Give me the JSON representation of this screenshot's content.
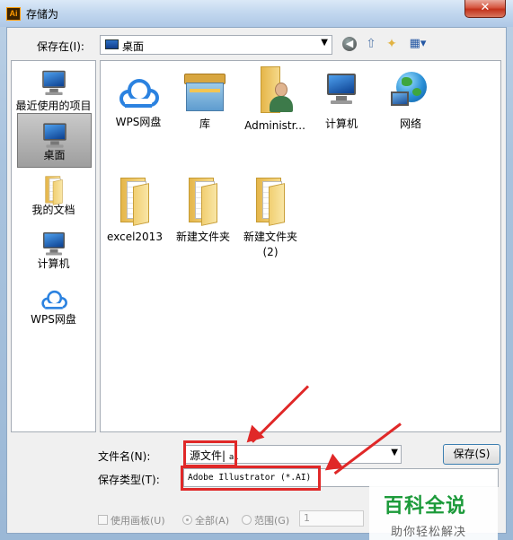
{
  "window": {
    "app_icon": "Ai",
    "title": "存储为",
    "close_label": "✕"
  },
  "toolbar": {
    "save_in_label": "保存在(I):",
    "save_in_value": "桌面",
    "icons": [
      "back-icon",
      "up-folder-icon",
      "new-folder-icon",
      "views-menu-icon"
    ]
  },
  "places": [
    {
      "label": "最近使用的项目",
      "icon": "recent-items-icon"
    },
    {
      "label": "桌面",
      "icon": "desktop-icon",
      "selected": true
    },
    {
      "label": "我的文档",
      "icon": "documents-icon"
    },
    {
      "label": "计算机",
      "icon": "computer-icon"
    },
    {
      "label": "WPS网盘",
      "icon": "wps-cloud-icon"
    }
  ],
  "files": [
    {
      "label": "WPS网盘",
      "icon": "wps-cloud-icon"
    },
    {
      "label": "库",
      "icon": "library-icon"
    },
    {
      "label": "Administr...",
      "icon": "user-folder-icon"
    },
    {
      "label": "计算机",
      "icon": "computer-icon"
    },
    {
      "label": "网络",
      "icon": "network-icon"
    },
    {
      "label": "excel2013",
      "icon": "folder-icon"
    },
    {
      "label": "新建文件夹",
      "icon": "folder-icon"
    },
    {
      "label": "新建文件夹",
      "label2": "(2)",
      "icon": "folder-icon"
    }
  ],
  "form": {
    "filename_label": "文件名(N):",
    "filename_value": "源文件",
    "filename_ext": "ai",
    "filetype_label": "保存类型(T):",
    "filetype_value": "Adobe Illustrator (*.AI)",
    "save_button": "保存(S)"
  },
  "options": {
    "use_artboards": "使用画板(U)",
    "all": "全部(A)",
    "range": "范围(G)",
    "range_value": "1"
  },
  "watermark": {
    "title": "百科全说",
    "subtitle": "助你轻松解决"
  },
  "colors": {
    "highlight": "#e02828",
    "watermark_green": "#1c9a3a"
  }
}
